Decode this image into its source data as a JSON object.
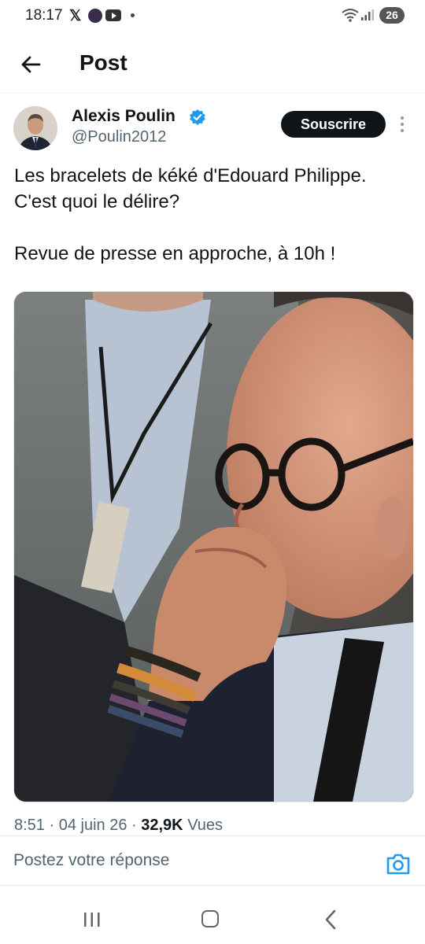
{
  "status_bar": {
    "time": "18:17",
    "x_logo": "𝕏",
    "battery": "26",
    "icons": [
      "x-app-icon",
      "app-icon",
      "youtube-icon",
      "notification-dot",
      "wifi-icon",
      "signal-icon",
      "battery-icon"
    ]
  },
  "header": {
    "title": "Post",
    "back_icon": "arrow-left-icon"
  },
  "author": {
    "name": "Alexis Poulin",
    "handle": "@Poulin2012",
    "verified_icon": "verified-badge-icon",
    "subscribe_label": "Souscrire",
    "more_icon": "more-vertical-icon"
  },
  "tweet": {
    "line1": "Les bracelets de kéké d'Edouard Philippe. C'est quoi le délire?",
    "line2": "Revue de presse en approche, à 10h !"
  },
  "meta": {
    "time": "8:51",
    "date": "04 juin 26",
    "views_count": "32,9K",
    "views_label": "Vues"
  },
  "reply": {
    "placeholder": "Postez votre réponse",
    "camera_icon": "camera-icon"
  },
  "nav": {
    "icons": [
      "recent-apps-icon",
      "home-icon",
      "back-icon"
    ]
  },
  "colors": {
    "verified": "#1d9bf0",
    "camera": "#1d9bf0",
    "text": "#0f1419",
    "secondary": "#536471"
  }
}
